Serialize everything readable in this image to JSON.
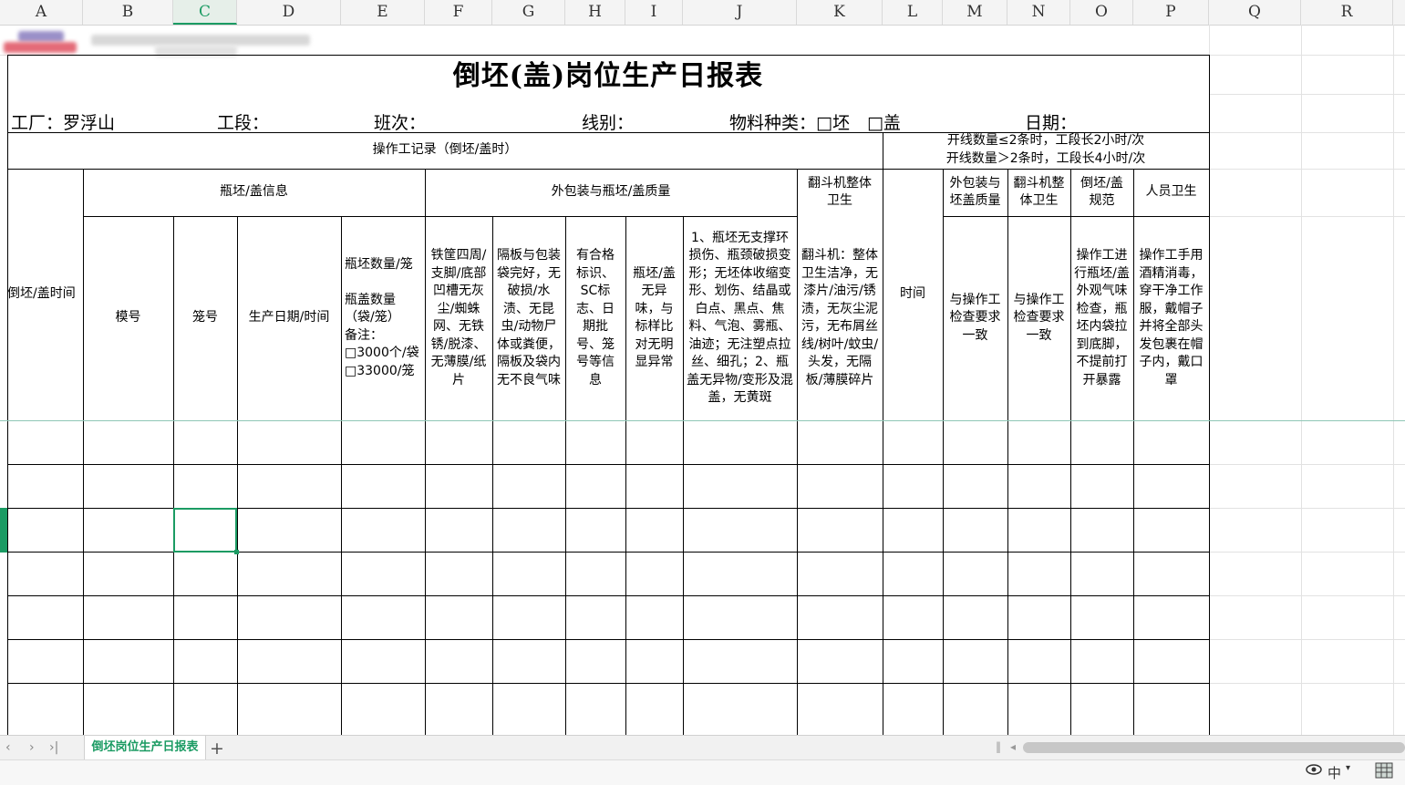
{
  "columns": [
    "A",
    "B",
    "C",
    "D",
    "E",
    "F",
    "G",
    "H",
    "I",
    "J",
    "K",
    "L",
    "M",
    "N",
    "O",
    "P",
    "Q",
    "R"
  ],
  "active_column": "C",
  "title": "倒坯(盖)岗位生产日报表",
  "info": {
    "factory": "工厂：罗浮山",
    "section": "工段：",
    "shift": "班次：",
    "line": "线别：",
    "material": "物料种类：□坯　□盖",
    "date": "日期："
  },
  "header": {
    "operator_record": "操作工记录（倒坯/盖时）",
    "leader_note_1": "开线数量≤2条时，工段长2小时/次",
    "leader_note_2": "开线数量＞2条时，工段长4小时/次",
    "time_col": "倒坯/盖时间",
    "bottle_info": "瓶坯/盖信息",
    "package_quality": "外包装与瓶坯/盖质量",
    "flip_machine_hygiene": "翻斗机整体卫生",
    "time": "时间",
    "outer_pack_quality": "外包装与坯盖质量",
    "flip_machine_hygiene_2": "翻斗机整体卫生",
    "pour_standard": "倒坯/盖规范",
    "personal_hygiene": "人员卫生",
    "mold_no": "模号",
    "cage_no": "笼号",
    "prod_date": "生产日期/时间",
    "qty": "瓶坯数量/笼\n\n瓶盖数量（袋/笼）\n备注：\n□3000个/袋\n□33000/笼",
    "f_desc": "铁筐四周/支脚/底部凹槽无灰尘/蜘蛛网、无铁锈/脱漆、无薄膜/纸片",
    "g_desc": "隔板与包装袋完好，无破损/水渍、无昆虫/动物尸体或粪便，隔板及袋内无不良气味",
    "h_desc": "有合格标识、SC标志、日期批号、笼号等信息",
    "i_desc": "瓶坯/盖无异味，与标样比对无明显异常",
    "j_desc": "1、瓶坯无支撑环损伤、瓶颈破损变形；无坯体收缩变形、划伤、结晶或白点、黑点、焦料、气泡、雾瓶、油迹；无注塑点拉丝、细孔；2、瓶盖无异物/变形及混盖，无黄斑",
    "k_desc": "翻斗机：整体卫生洁净，无漆片/油污/锈渍，无灰尘泥污，无布屑丝线/树叶/蚊虫/头发，无隔板/薄膜碎片",
    "m_desc": "与操作工检查要求一致",
    "n_desc": "与操作工检查要求一致",
    "o_desc": "操作工进行瓶坯/盖外观气味检查，瓶坯内袋拉到底脚，不提前打开暴露",
    "p_desc": "操作工手用酒精消毒，穿干净工作服，戴帽子并将全部头发包裹在帽子内，戴口罩"
  },
  "sheet_tab": "倒坯岗位生产日报表",
  "add_tab": "+",
  "nav": [
    "‹",
    "›",
    "›|"
  ],
  "status": {
    "view_icon": "eye-icon",
    "ime": "中",
    "layout_icon": "grid-view-icon"
  },
  "colors": {
    "accent": "#1b9b63"
  }
}
